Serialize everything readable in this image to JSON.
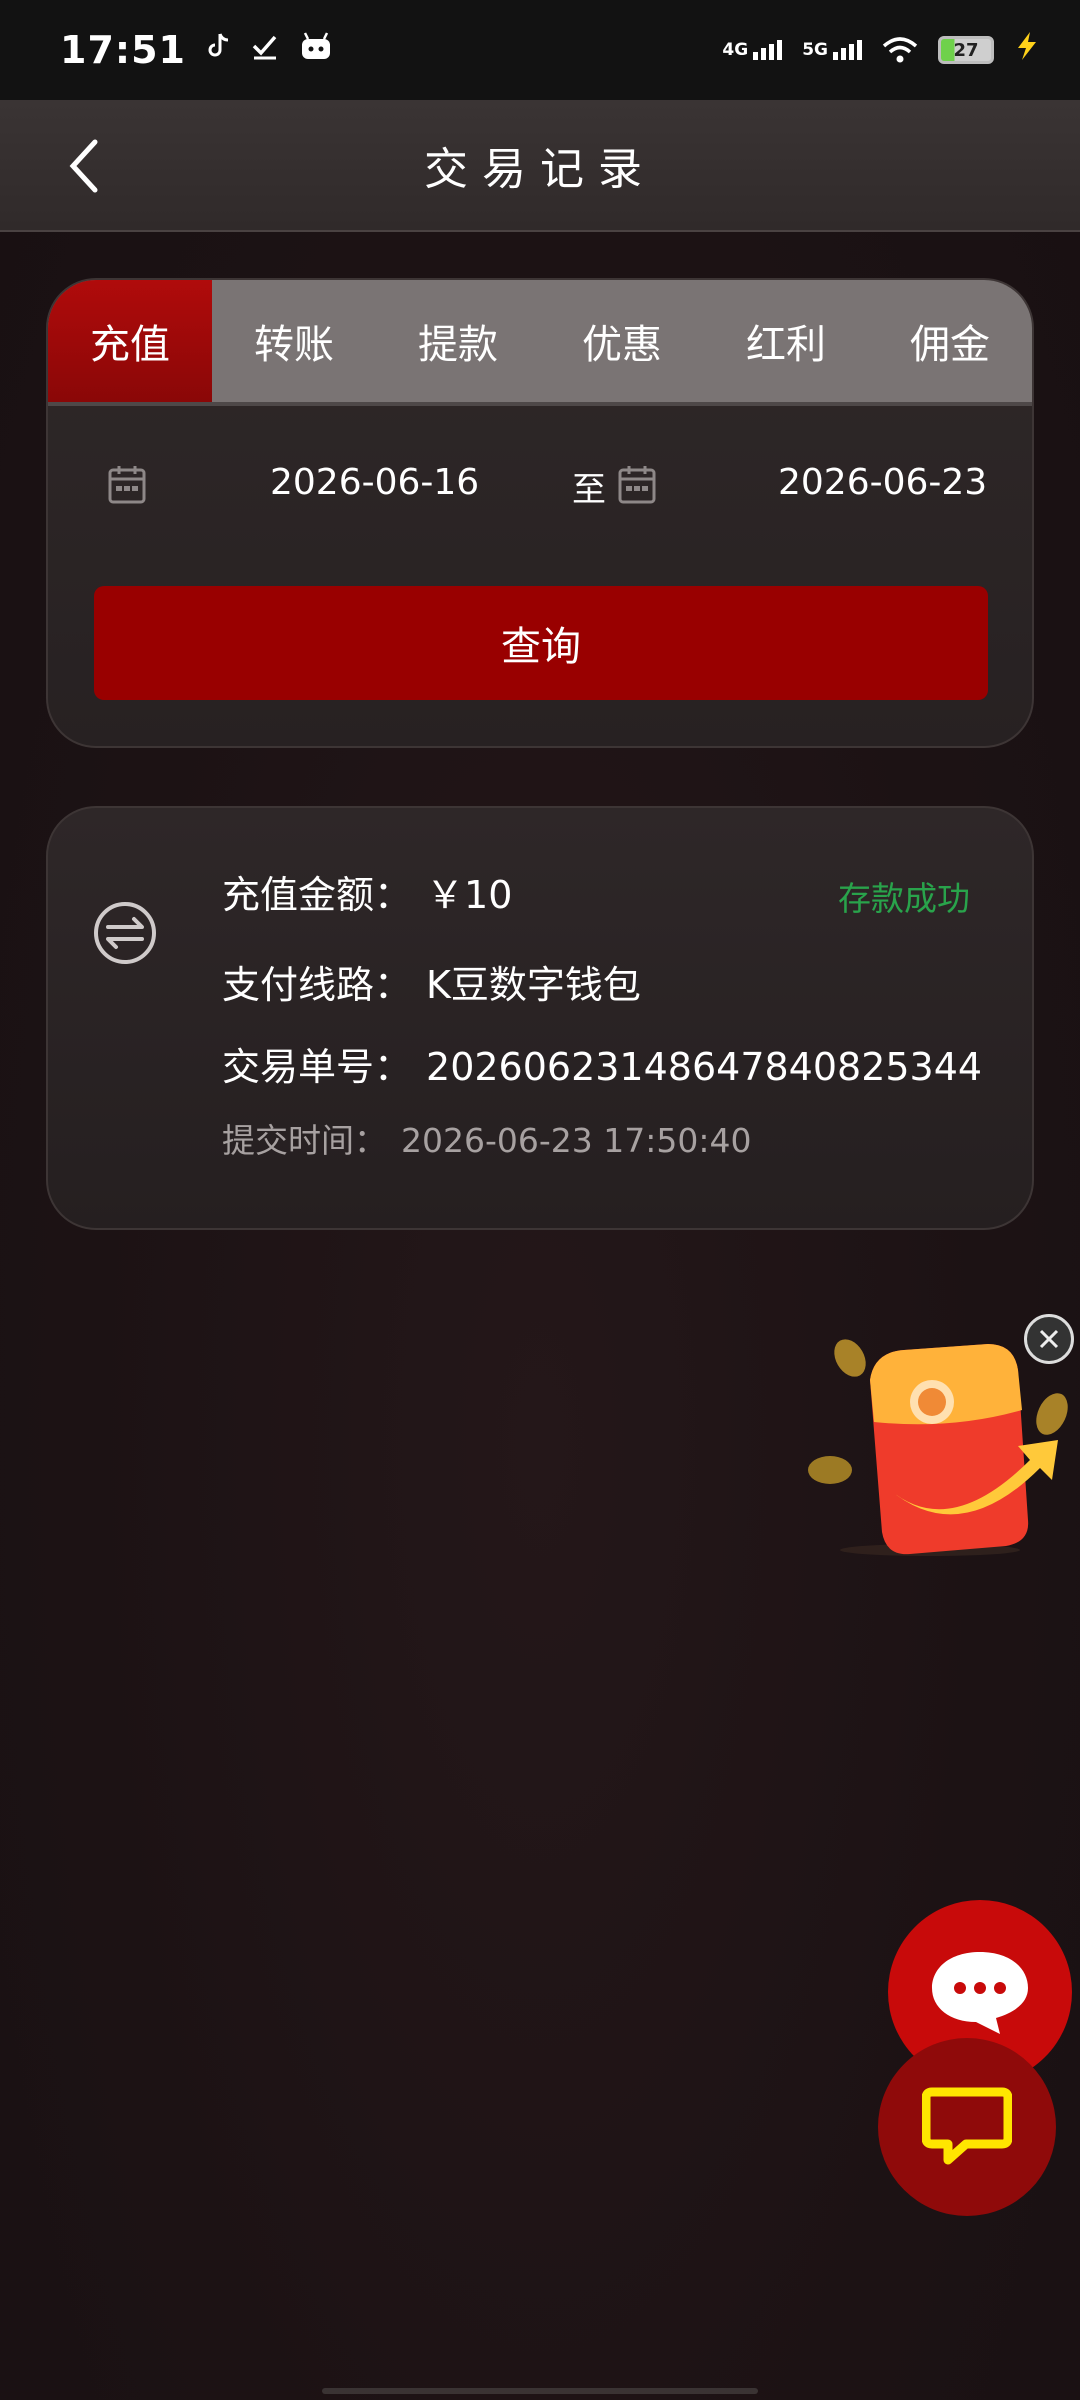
{
  "status_bar": {
    "time": "17:51",
    "left_icons": [
      "tiktok-icon",
      "check-icon",
      "bot-icon"
    ],
    "network_1": "4G",
    "network_2": "5G",
    "battery": "27"
  },
  "header": {
    "title": "交易记录",
    "back_icon": "chevron-left-icon"
  },
  "tabs": [
    {
      "label": "充值",
      "active": true
    },
    {
      "label": "转账",
      "active": false
    },
    {
      "label": "提款",
      "active": false
    },
    {
      "label": "优惠",
      "active": false
    },
    {
      "label": "红利",
      "active": false
    },
    {
      "label": "佣金",
      "active": false
    }
  ],
  "filter": {
    "start_date": "2026-06-16",
    "to_label": "至",
    "end_date": "2026-06-23",
    "query_label": "查询"
  },
  "record": {
    "icon": "swap-icon",
    "amount_label": "充值金额：",
    "amount_value": "￥10",
    "status": "存款成功",
    "status_color": "#29a34b",
    "channel_label": "支付线路：",
    "channel_value": "K豆数字钱包",
    "order_label": "交易单号：",
    "order_value": "2026062314864784082534​4",
    "time_label": "提交时间：",
    "time_value": "2026-06-23 17:50:40"
  },
  "colors": {
    "accent": "#990000",
    "tab_bg": "#7a7474",
    "background": "#1c1214"
  }
}
